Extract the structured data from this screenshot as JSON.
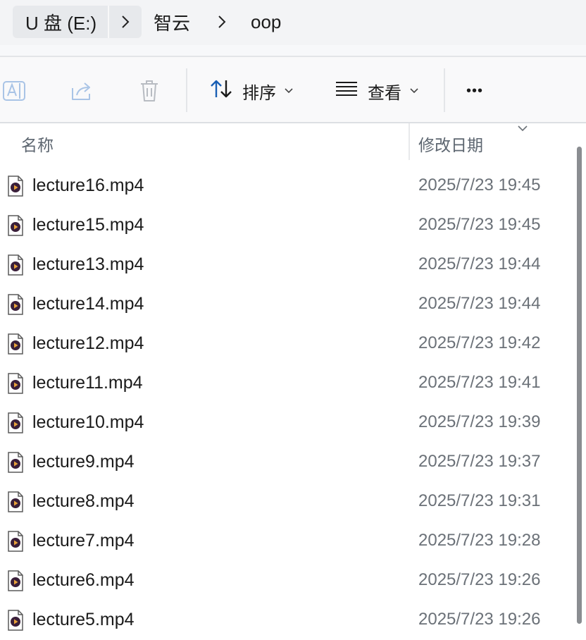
{
  "breadcrumb": {
    "drive": "U 盘 (E:)",
    "items": [
      "智云",
      "oop"
    ]
  },
  "toolbar": {
    "sort_label": "排序",
    "view_label": "查看",
    "more_label": "•••"
  },
  "columns": {
    "name": "名称",
    "modified": "修改日期"
  },
  "files": [
    {
      "name": "lecture16.mp4",
      "modified": "2025/7/23 19:45"
    },
    {
      "name": "lecture15.mp4",
      "modified": "2025/7/23 19:45"
    },
    {
      "name": "lecture13.mp4",
      "modified": "2025/7/23 19:44"
    },
    {
      "name": "lecture14.mp4",
      "modified": "2025/7/23 19:44"
    },
    {
      "name": "lecture12.mp4",
      "modified": "2025/7/23 19:42"
    },
    {
      "name": "lecture11.mp4",
      "modified": "2025/7/23 19:41"
    },
    {
      "name": "lecture10.mp4",
      "modified": "2025/7/23 19:39"
    },
    {
      "name": "lecture9.mp4",
      "modified": "2025/7/23 19:37"
    },
    {
      "name": "lecture8.mp4",
      "modified": "2025/7/23 19:31"
    },
    {
      "name": "lecture7.mp4",
      "modified": "2025/7/23 19:28"
    },
    {
      "name": "lecture6.mp4",
      "modified": "2025/7/23 19:26"
    },
    {
      "name": "lecture5.mp4",
      "modified": "2025/7/23 19:26"
    }
  ],
  "icons": {
    "rename": "rename-icon",
    "share": "share-icon",
    "delete": "trash-icon",
    "sort": "sort-arrows-icon",
    "view": "view-lines-icon",
    "more": "more-dots-icon",
    "file": "video-file-icon"
  },
  "colors": {
    "accent": "#1a5fb4",
    "icon_disabled": "#a9c4e6",
    "date_text": "#6b7178"
  }
}
